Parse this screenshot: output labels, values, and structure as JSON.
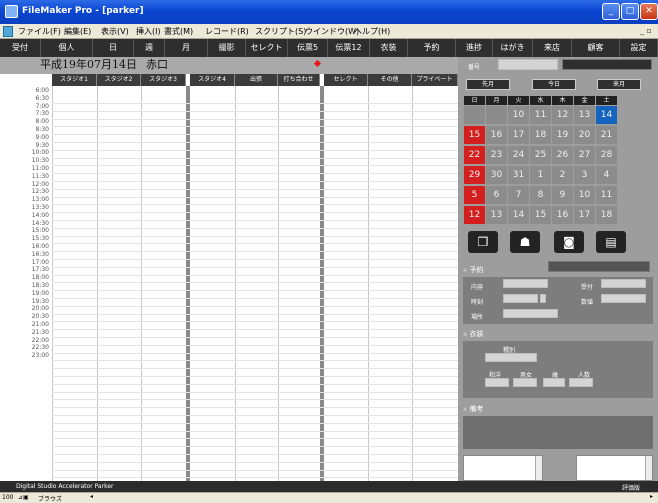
{
  "window": {
    "title": "FileMaker Pro - [parker]"
  },
  "menu": [
    "ファイル(F)",
    "編集(E)",
    "表示(V)",
    "挿入(I)",
    "書式(M)",
    "レコード(R)",
    "スクリプト(S)",
    "ウインドウ(W)",
    "ヘルプ(H)"
  ],
  "nav": [
    "受付",
    "個人",
    "日",
    "週",
    "月",
    "撮影",
    "セレクト",
    "伝票5",
    "伝票12",
    "衣装",
    "予約",
    "進捗",
    "はがき",
    "来店",
    "顧客",
    "設定"
  ],
  "header": {
    "date": "平成19年07月14日",
    "room": "赤口"
  },
  "columns": [
    "スタジオ1",
    "スタジオ2",
    "スタジオ3",
    "スタジオ4",
    "出張",
    "打ち合わせ",
    "セレクト",
    "その他",
    "プライベート"
  ],
  "times": [
    "6:00",
    "6:30",
    "7:00",
    "7:30",
    "8:00",
    "8:30",
    "9:00",
    "9:30",
    "10:00",
    "10:30",
    "11:00",
    "11:30",
    "12:00",
    "12:30",
    "13:00",
    "13:30",
    "14:00",
    "14:30",
    "15:00",
    "15:30",
    "16:00",
    "16:30",
    "17:00",
    "17:30",
    "18:00",
    "18:30",
    "19:00",
    "19:30",
    "20:00",
    "20:30",
    "21:00",
    "21:30",
    "22:00",
    "22:30",
    "23:00"
  ],
  "right": {
    "staff_label": "番号",
    "prev": "先月",
    "today": "今日",
    "next": "来月"
  },
  "calendar": {
    "dow": [
      "日",
      "月",
      "火",
      "水",
      "木",
      "金",
      "土"
    ],
    "weeks": [
      [
        "",
        "",
        "10",
        "11",
        "12",
        "13",
        "14"
      ],
      [
        "15",
        "16",
        "17",
        "18",
        "19",
        "20",
        "21"
      ],
      [
        "22",
        "23",
        "24",
        "25",
        "26",
        "27",
        "28"
      ],
      [
        "29",
        "30",
        "31",
        "1",
        "2",
        "3",
        "4"
      ],
      [
        "5",
        "6",
        "7",
        "8",
        "9",
        "10",
        "11"
      ],
      [
        "12",
        "13",
        "14",
        "15",
        "16",
        "17",
        "18"
      ]
    ],
    "today": "14",
    "colors": {
      "sunday": "#d41f1f",
      "today": "#1565c0",
      "cell": "#8c8c8c"
    }
  },
  "reservation": {
    "title": "予約",
    "content": "内容",
    "reception": "受付",
    "time": "時刻",
    "count": "数値",
    "place": "場所"
  },
  "costume": {
    "title": "衣装",
    "type": "種別",
    "kimono": "和洋",
    "male": "男女",
    "age": "歳",
    "people": "人数"
  },
  "notes": {
    "title": "備考"
  },
  "status": {
    "left": "Digital Studio Accelerator Parker",
    "right": "評価版"
  },
  "bottombar": {
    "zoom": "100",
    "mode": "ブラウズ"
  },
  "icons": [
    "book-icon",
    "person-icon",
    "camera-icon",
    "document-icon"
  ]
}
